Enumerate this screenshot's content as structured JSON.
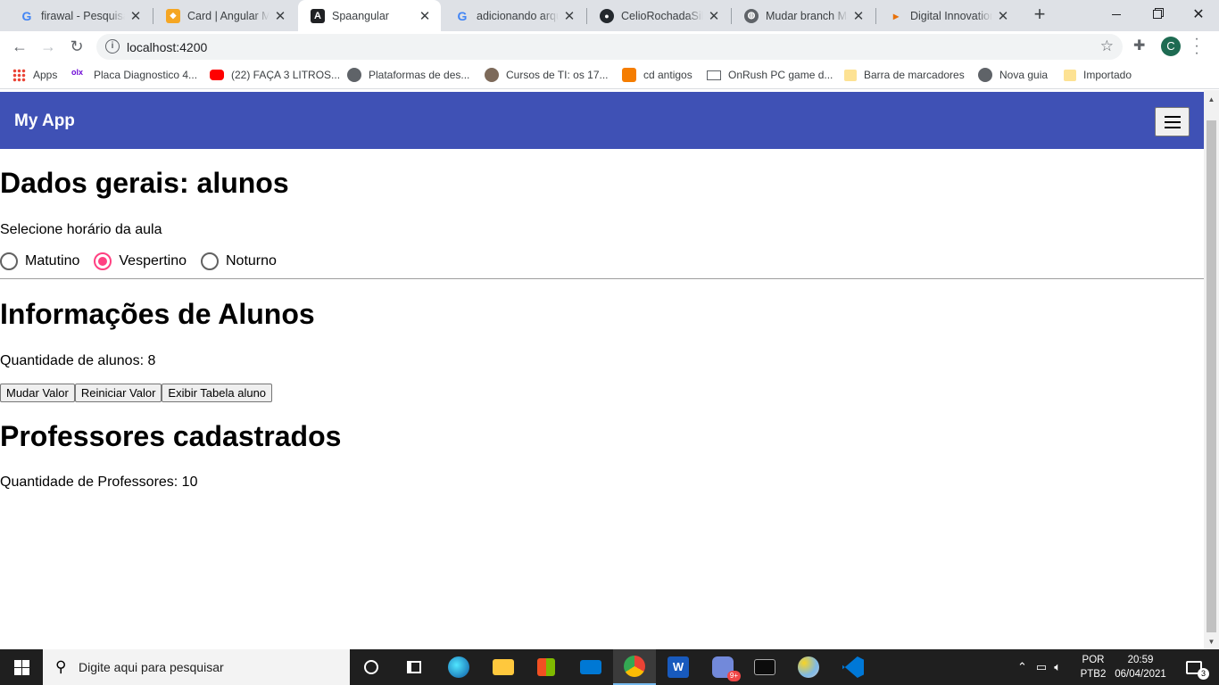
{
  "browser": {
    "tabs": [
      {
        "title": "firawal - Pesquisa Google",
        "icon": "google-icon"
      },
      {
        "title": "Card | Angular Material",
        "icon": "shield-icon"
      },
      {
        "title": "Spaangular",
        "icon": "angular-icon",
        "active": true
      },
      {
        "title": "adicionando arquivo",
        "icon": "google-icon"
      },
      {
        "title": "CelioRochadaSilva",
        "icon": "github-icon"
      },
      {
        "title": "Mudar branch Mac",
        "icon": "globe-icon"
      },
      {
        "title": "Digital Innovation One",
        "icon": "dio-icon"
      }
    ],
    "new_tab": "+",
    "url": "localhost:4200",
    "profile_initial": "C",
    "bookmarks": [
      {
        "label": "Apps",
        "icon": "apps-grid-icon"
      },
      {
        "label": "Placa Diagnostico 4...",
        "icon": "olx-icon"
      },
      {
        "label": "(22) FAÇA 3 LITROS...",
        "icon": "youtube-icon"
      },
      {
        "label": "Plataformas de des...",
        "icon": "globe-icon"
      },
      {
        "label": "Cursos de TI: os 17...",
        "icon": "person-icon"
      },
      {
        "label": "cd antigos",
        "icon": "blogger-icon"
      },
      {
        "label": "OnRush PC game d...",
        "icon": "laptop-icon"
      },
      {
        "label": "Barra de marcadores",
        "icon": "folder-icon"
      },
      {
        "label": "Nova guia",
        "icon": "globe-icon"
      },
      {
        "label": "Importado",
        "icon": "folder-icon"
      }
    ]
  },
  "app": {
    "brand": "My App",
    "accent": "#3f51b5",
    "radio_accent": "#ff4081",
    "section1_title": "Dados gerais: alunos",
    "schedule_label": "Selecione horário da aula",
    "schedule_options": [
      "Matutino",
      "Vespertino",
      "Noturno"
    ],
    "schedule_selected": "Vespertino",
    "section2_title": "Informações de Alunos",
    "students_count_text": "Quantidade de alunos: 8",
    "buttons": [
      "Mudar Valor",
      "Reiniciar Valor",
      "Exibir Tabela aluno"
    ],
    "section3_title": "Professores cadastrados",
    "teachers_count_text": "Quantidade de Professores: 10"
  },
  "taskbar": {
    "search_placeholder": "Digite aqui para pesquisar",
    "lang_top": "POR",
    "lang_bottom": "PTB2",
    "time": "20:59",
    "date": "06/04/2021",
    "notification_count": "3",
    "discord_badge": "9+"
  }
}
